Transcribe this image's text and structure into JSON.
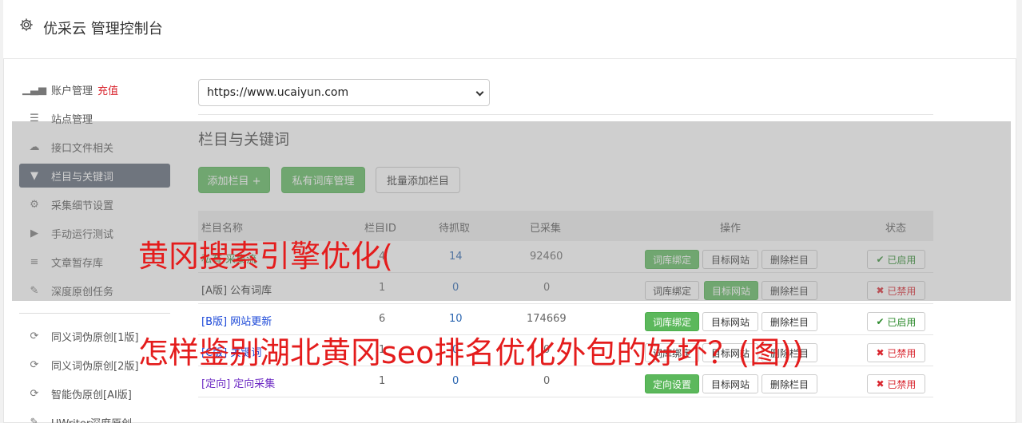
{
  "header": {
    "title": "优采云 管理控制台",
    "icon": "gear-icon"
  },
  "sidebar": {
    "recharge": "充值",
    "items": [
      {
        "label": "账户管理",
        "icon": "bar-chart-icon"
      },
      {
        "label": "站点管理",
        "icon": "server-icon"
      },
      {
        "label": "接口文件相关",
        "icon": "cloud-upload-icon"
      },
      {
        "label": "栏目与关键词",
        "icon": "filter-icon"
      },
      {
        "label": "采集细节设置",
        "icon": "cogs-icon"
      },
      {
        "label": "手动运行测试",
        "icon": "play-circle-icon"
      },
      {
        "label": "文章暂存库",
        "icon": "database-icon"
      },
      {
        "label": "深度原创任务",
        "icon": "edit-icon"
      },
      {
        "label": "同义词伪原创[1版]",
        "icon": "refresh-icon"
      },
      {
        "label": "同义词伪原创[2版]",
        "icon": "refresh-icon"
      },
      {
        "label": "智能伪原创[AI版]",
        "icon": "refresh-icon"
      },
      {
        "label": "UWriter深度原创",
        "icon": "edit-icon"
      }
    ]
  },
  "site_select": {
    "value": "https://www.ucaiyun.com"
  },
  "section": {
    "title": "栏目与关键词"
  },
  "toolbar": {
    "add_column": "添加栏目 +",
    "private_lib": "私有词库管理",
    "batch_add": "批量添加栏目"
  },
  "table": {
    "headers": {
      "name": "栏目名称",
      "id": "栏目ID",
      "pending": "待抓取",
      "collected": "已采集",
      "ops": "操作",
      "status": "状态"
    },
    "rows": [
      {
        "name": "私有 采集流",
        "id": "4",
        "pending": "14",
        "collected": "92460",
        "op1": "词库绑定",
        "op2": "目标网站",
        "op3": "删除栏目",
        "status": "已启用"
      },
      {
        "name": "[A版] 公有词库",
        "id": "1",
        "pending": "0",
        "collected": "0",
        "op1": "词库绑定",
        "op2": "目标网站",
        "op3": "删除栏目",
        "status": "已禁用"
      },
      {
        "tag": "[B版]",
        "name": "网站更新",
        "id": "6",
        "pending": "10",
        "collected": "174669",
        "op1": "词库绑定",
        "op2": "目标网站",
        "op3": "删除栏目",
        "status": "已启用"
      },
      {
        "tag": "[C版]",
        "name": "关键词",
        "id": "1",
        "pending": "0",
        "collected": "0",
        "op1": "词库绑定",
        "op2": "目标网站",
        "op3": "删除栏目",
        "status": "已禁用"
      },
      {
        "tag": "[定向]",
        "name": "定向采集",
        "id": "1",
        "pending": "0",
        "collected": "0",
        "op1": "定向设置",
        "op2": "目标网站",
        "op3": "删除栏目",
        "status": "已禁用"
      }
    ]
  },
  "watermark": {
    "line1": "黄冈搜索引擎优化(",
    "line2": "怎样鉴别湖北黄冈seo排名优化外包的好坏？(图))"
  }
}
